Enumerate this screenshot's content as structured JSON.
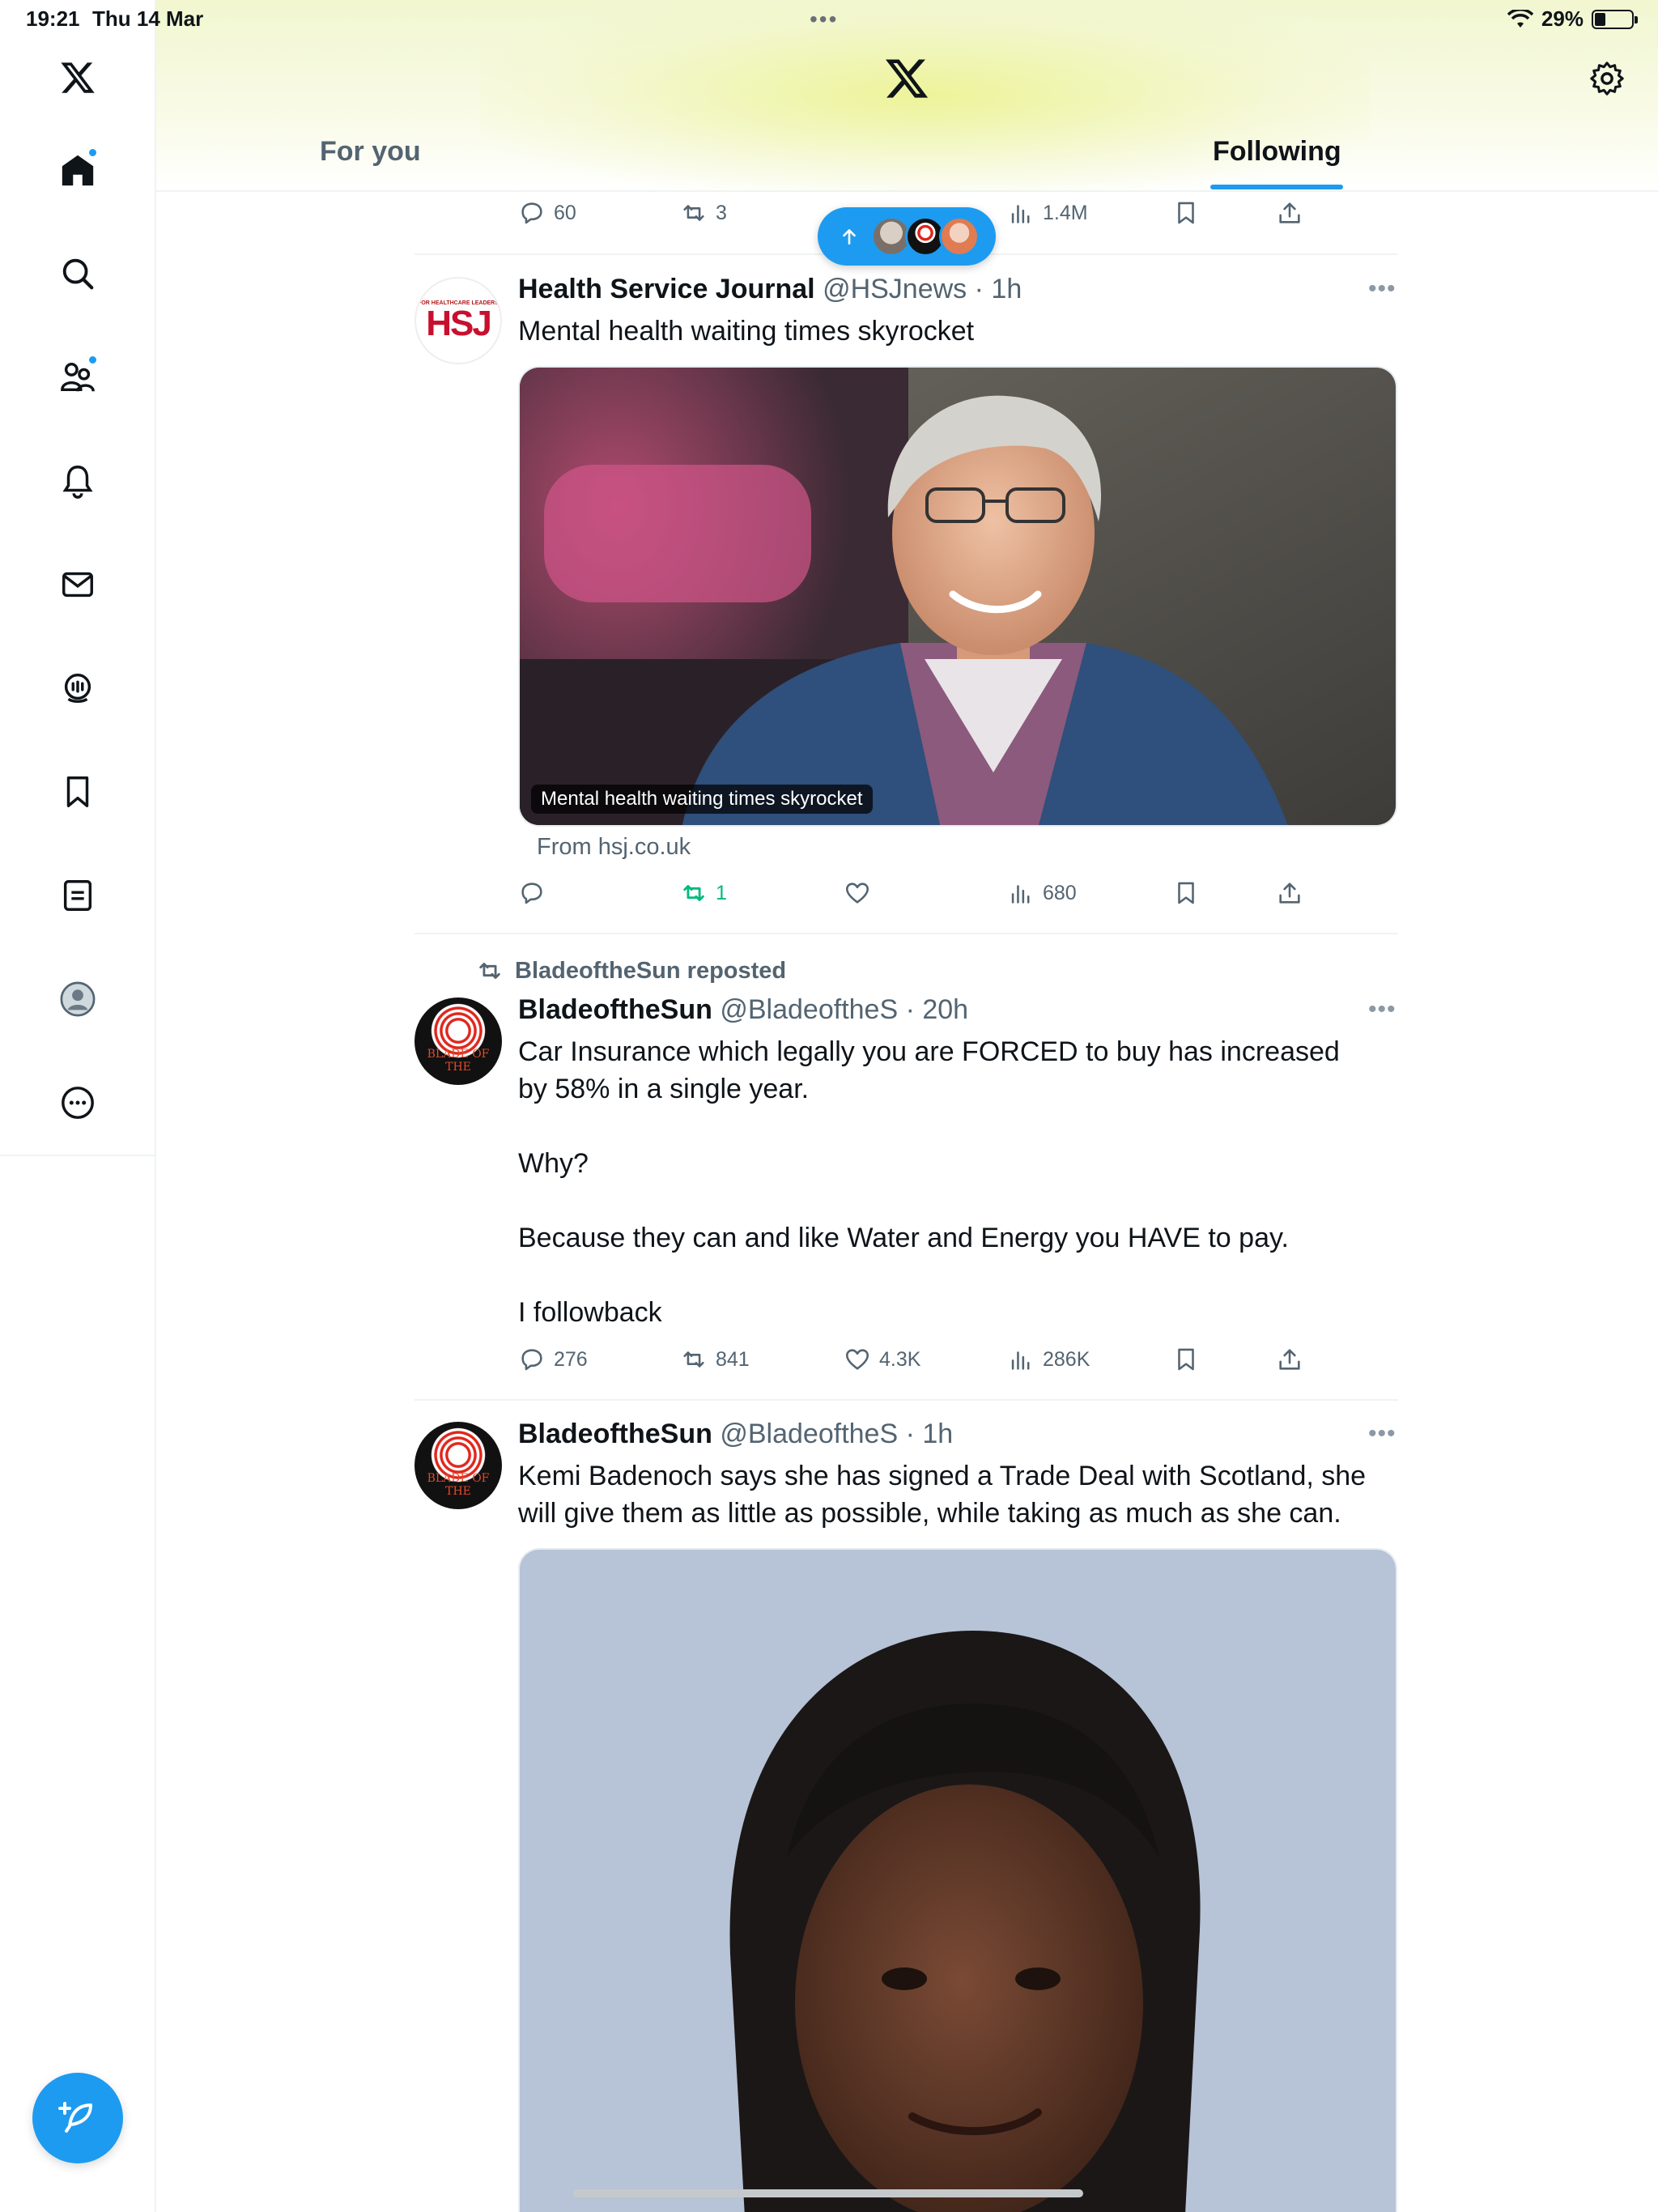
{
  "status": {
    "time": "19:21",
    "date": "Thu 14 Mar",
    "battery": "29%",
    "battery_level": 0.29
  },
  "sidebar": {
    "items": [
      {
        "name": "x-logo-icon"
      },
      {
        "name": "home-icon"
      },
      {
        "name": "search-icon"
      },
      {
        "name": "communities-icon"
      },
      {
        "name": "notifications-icon"
      },
      {
        "name": "messages-icon"
      },
      {
        "name": "grok-icon"
      },
      {
        "name": "bookmarks-icon"
      },
      {
        "name": "lists-icon"
      },
      {
        "name": "profile-icon"
      },
      {
        "name": "more-icon"
      }
    ],
    "compose_icon": "feather-plus-icon"
  },
  "header": {
    "tabs": [
      {
        "label": "For you"
      },
      {
        "label": "Following"
      }
    ],
    "active_tab": "Following"
  },
  "accent": "#1d9bf0",
  "top_partial_tweet": {
    "replies": "60",
    "reposts": "3",
    "views": "1.4M"
  },
  "tweets": [
    {
      "name": "Health Service Journal",
      "handle": "@HSJnews",
      "time": "1h",
      "text": "Mental health waiting times skyrocket",
      "avatar_big": "HSJ",
      "avatar_small": "FOR HEALTHCARE LEADERS",
      "media_caption": "Mental health waiting times skyrocket",
      "from": "From hsj.co.uk",
      "replies": "",
      "reposts": "1",
      "likes": "",
      "views": "680"
    },
    {
      "repost_by": "BladeoftheSun reposted",
      "name": "BladeoftheSun",
      "handle": "@BladeoftheS",
      "time": "20h",
      "avatar_text": "BLADE OF THE",
      "text": "Car Insurance which legally you are FORCED to buy has increased by 58% in a single year.\n\nWhy?\n\nBecause they can and like Water and Energy you HAVE to pay.\n\nI followback",
      "replies": "276",
      "reposts": "841",
      "likes": "4.3K",
      "views": "286K"
    },
    {
      "name": "BladeoftheSun",
      "handle": "@BladeoftheS",
      "time": "1h",
      "avatar_text": "BLADE OF THE",
      "text": "Kemi Badenoch says she has signed a Trade Deal with Scotland, she will give them as little as possible, while taking as much as she can."
    }
  ]
}
